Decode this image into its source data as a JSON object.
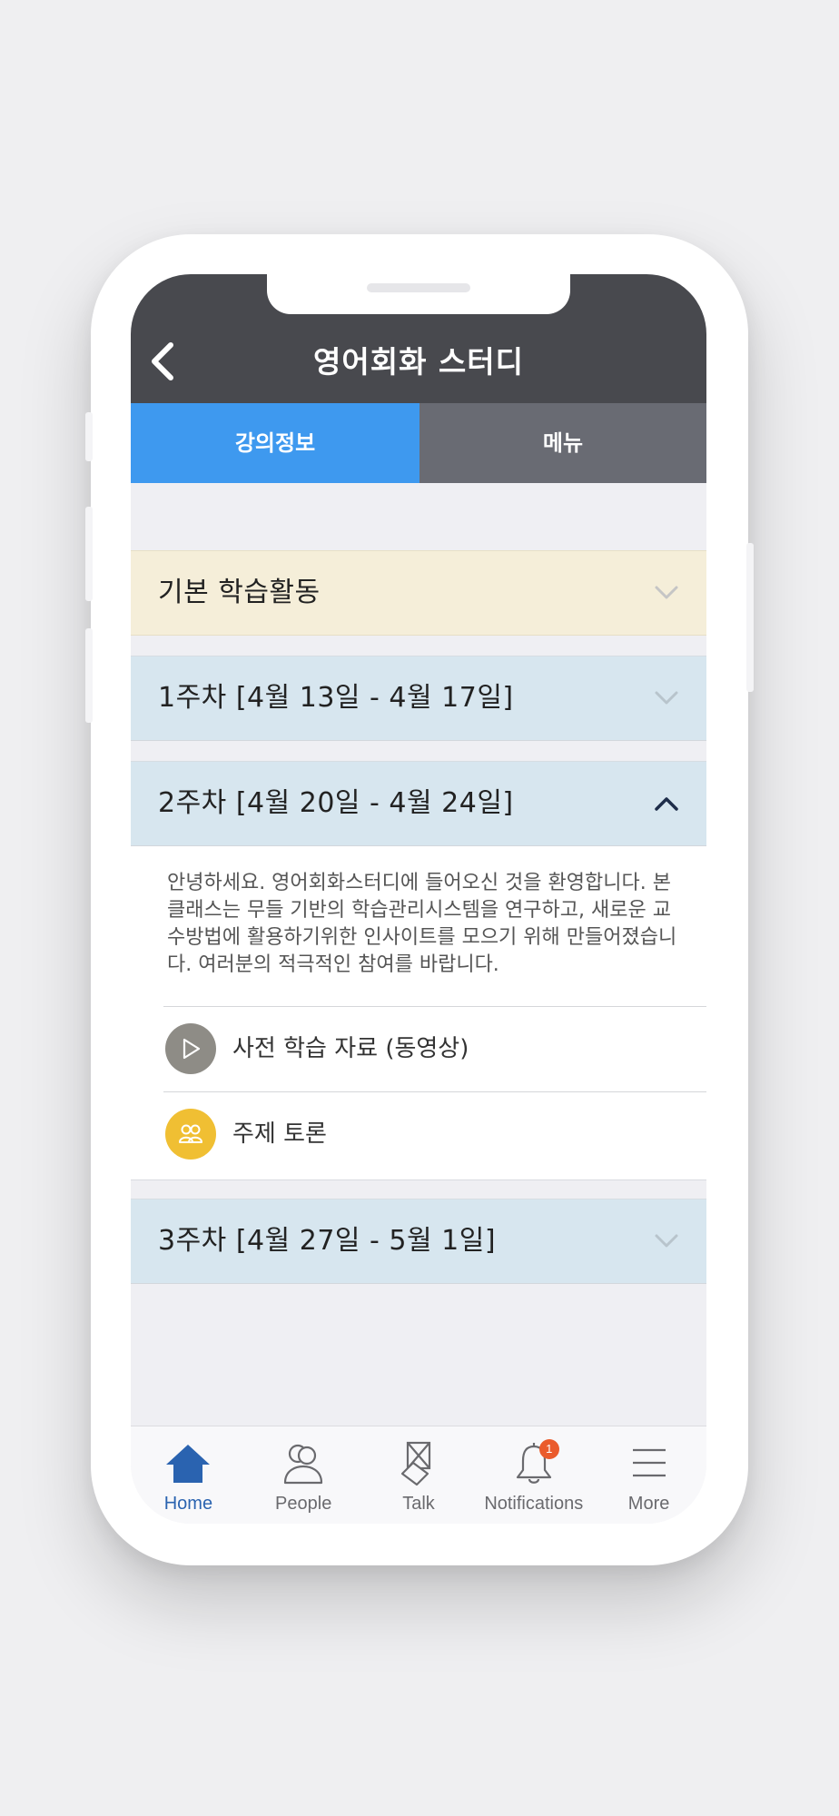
{
  "header": {
    "title": "영어회화 스터디"
  },
  "tabs": [
    {
      "label": "강의정보",
      "active": true
    },
    {
      "label": "메뉴",
      "active": false
    }
  ],
  "sections": [
    {
      "title": "기본 학습활동",
      "expanded": false
    },
    {
      "title": "1주차 [4월 13일 - 4월 17일]",
      "expanded": false
    },
    {
      "title": "2주차 [4월 20일 - 4월 24일]",
      "expanded": true,
      "description": "안녕하세요. 영어회화스터디에 들어오신 것을 환영합니다. 본 클래스는 무들 기반의 학습관리시스템을 연구하고, 새로운 교수방법에 활용하기위한 인사이트를 모으기 위해 만들어졌습니다. 여러분의 적극적인 참여를 바랍니다.",
      "items": [
        {
          "label": "사전 학습 자료 (동영상)",
          "icon": "play-icon"
        },
        {
          "label": "주제 토론",
          "icon": "people-icon"
        }
      ]
    },
    {
      "title": "3주차 [4월 27일 - 5월 1일]",
      "expanded": false
    }
  ],
  "bottom_nav": [
    {
      "label": "Home",
      "icon": "home-icon",
      "active": true
    },
    {
      "label": "People",
      "icon": "people-icon",
      "active": false
    },
    {
      "label": "Talk",
      "icon": "talk-icon",
      "active": false
    },
    {
      "label": "Notifications",
      "icon": "bell-icon",
      "active": false,
      "badge": "1"
    },
    {
      "label": "More",
      "icon": "menu-icon",
      "active": false
    }
  ],
  "colors": {
    "header": "#48494e",
    "tab_active": "#3e99ef",
    "tab_inactive": "#696b73",
    "basic_section": "#f5eed9",
    "week_section": "#d7e6ef",
    "nav_active": "#2a63b0",
    "badge": "#ea5b2c"
  }
}
